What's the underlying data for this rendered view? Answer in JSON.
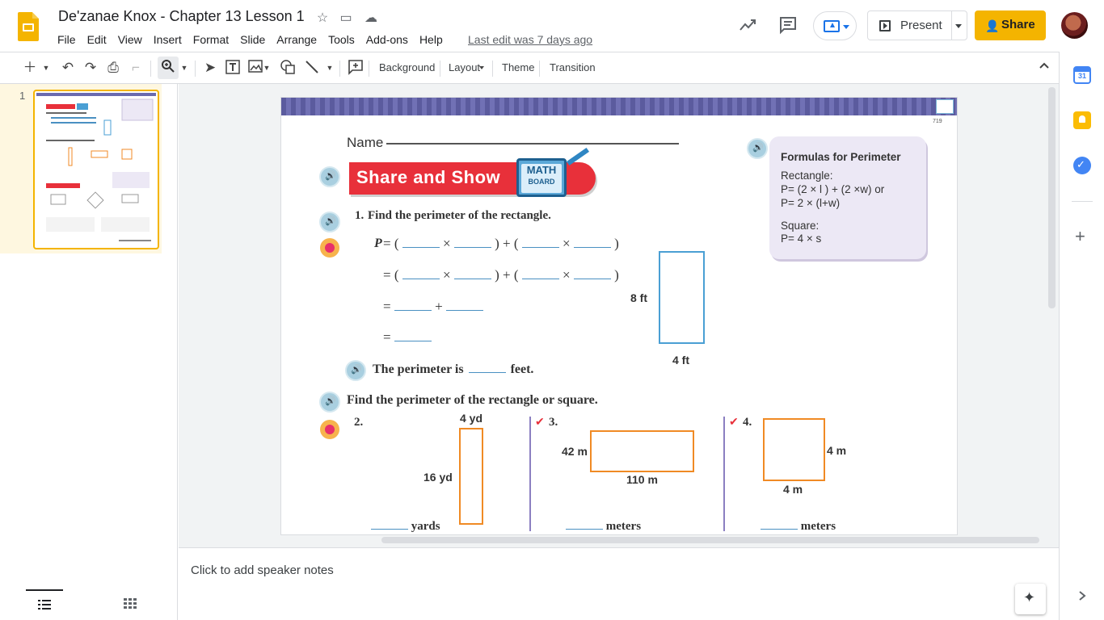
{
  "app": {
    "doc_title": "De'zanae Knox - Chapter 13 Lesson 1",
    "menu": [
      "File",
      "Edit",
      "View",
      "Insert",
      "Format",
      "Slide",
      "Arrange",
      "Tools",
      "Add-ons",
      "Help"
    ],
    "last_edit": "Last edit was 7 days ago",
    "present_label": "Present",
    "share_label": "Share"
  },
  "toolbar": {
    "background_label": "Background",
    "layout_label": "Layout",
    "theme_label": "Theme",
    "transition_label": "Transition"
  },
  "filmstrip": {
    "slide_number": "1"
  },
  "slide": {
    "page_number": "719",
    "name_label": "Name",
    "share_show": "Share and Show",
    "math_board": [
      "MATH",
      "BOARD"
    ],
    "formulas": {
      "title": "Formulas for Perimeter",
      "rect_label": "Rectangle:",
      "rect_f1": "P= (2 × l ) + (2 ×w) or",
      "rect_f2": "P= 2 × (l+w)",
      "square_label": "Square:",
      "square_f": "P= 4 × s"
    },
    "q1": {
      "num": "1.",
      "text": "Find the perimeter of the rectangle.",
      "p_label": "P",
      "height_label": "8 ft",
      "width_label": "4 ft",
      "answer_pre": "The perimeter is",
      "answer_post": "feet."
    },
    "find_text": "Find the perimeter of the rectangle or square.",
    "q2": {
      "num": "2.",
      "top": "4 yd",
      "side": "16 yd",
      "unit": "yards"
    },
    "q3": {
      "num": "3.",
      "side": "42 m",
      "bottom": "110 m",
      "unit": "meters"
    },
    "q4": {
      "num": "4.",
      "side": "4 m",
      "bottom": "4 m",
      "unit": "meters"
    }
  },
  "notes": {
    "placeholder": "Click to add speaker notes"
  },
  "colors": {
    "brand_yellow": "#f4b400",
    "share_red": "#e8303a",
    "shape_blue": "#4a9fd4",
    "shape_orange": "#f08a24"
  }
}
